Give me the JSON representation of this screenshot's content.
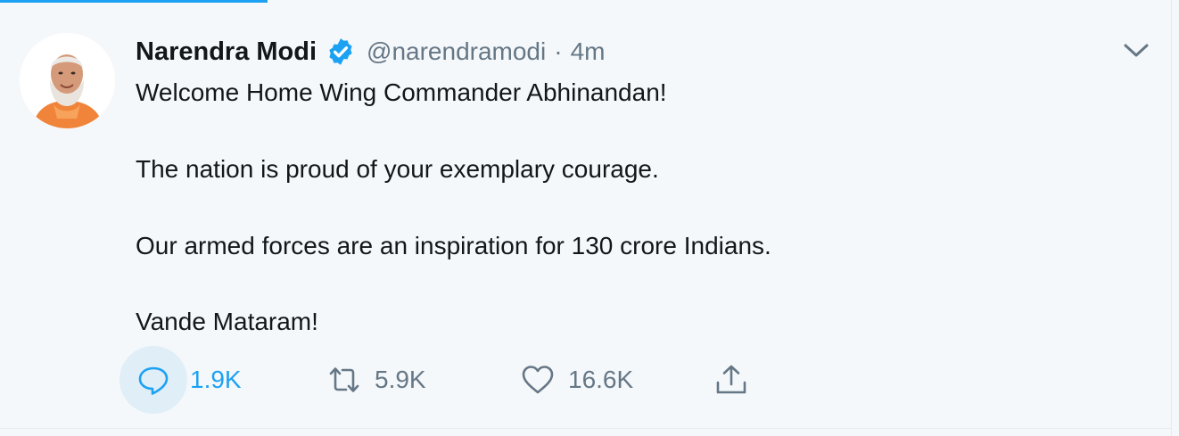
{
  "tweet": {
    "author_name": "Narendra Modi",
    "handle": "@narendramodi",
    "separator": "·",
    "timestamp": "4m",
    "verified": true,
    "lines": [
      "Welcome Home Wing Commander Abhinandan!",
      "The nation is proud of your exemplary courage.",
      "Our armed forces are an inspiration for 130 crore Indians.",
      "Vande Mataram!"
    ]
  },
  "actions": {
    "reply": {
      "icon": "reply-icon",
      "count": "1.9K"
    },
    "retweet": {
      "icon": "retweet-icon",
      "count": "5.9K"
    },
    "like": {
      "icon": "heart-icon",
      "count": "16.6K"
    },
    "share": {
      "icon": "share-icon"
    }
  },
  "colors": {
    "background": "#f5f8fa",
    "accent": "#1da1f2",
    "text_primary": "#14171a",
    "text_secondary": "#657786"
  }
}
